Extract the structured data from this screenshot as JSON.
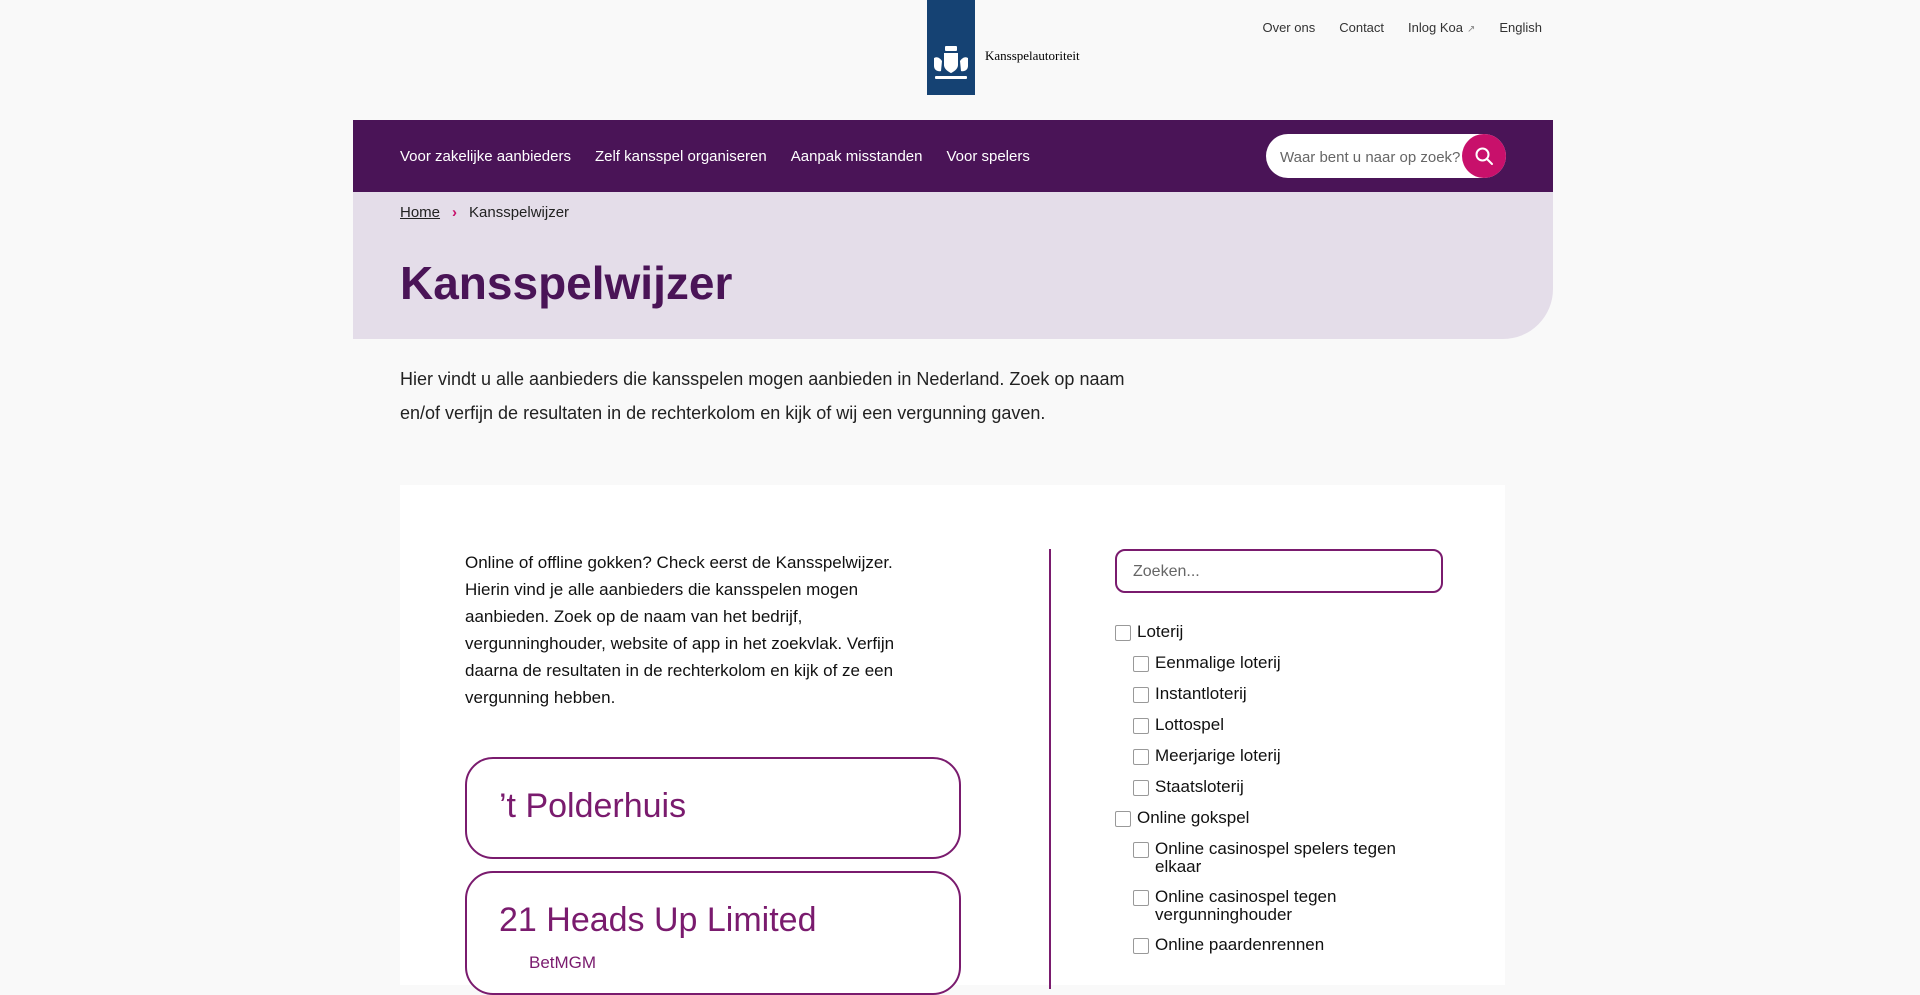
{
  "header": {
    "org_name": "Kansspelautoriteit",
    "top_links": [
      {
        "label": "Over ons"
      },
      {
        "label": "Contact"
      },
      {
        "label": "Inlog Koa",
        "external_icon": "external-link-icon"
      },
      {
        "label": "English"
      }
    ]
  },
  "nav": {
    "items": [
      {
        "label": "Voor zakelijke aanbieders"
      },
      {
        "label": "Zelf kansspel organiseren"
      },
      {
        "label": "Aanpak misstanden"
      },
      {
        "label": "Voor spelers"
      }
    ],
    "search_placeholder": "Waar bent u naar op zoek?",
    "search_icon": "search-icon"
  },
  "breadcrumb": {
    "home": "Home",
    "current": "Kansspelwijzer"
  },
  "page": {
    "title": "Kansspelwijzer",
    "intro": "Hier vindt u alle aanbieders die kansspelen mogen aanbieden in Nederland. Zoek op naam en/of verfijn de resultaten in de rechterkolom en kijk of wij een vergunning gaven."
  },
  "tool": {
    "description": "Online of offline gokken? Check eerst de Kansspelwijzer. Hierin vind je alle aanbieders die kansspelen mogen aanbieden. Zoek op de naam van het bedrijf, vergunninghouder, website of app in het zoekvlak. Verfijn daarna de resultaten in de rechterkolom en kijk of ze een vergunning hebben.",
    "results": [
      {
        "name": "’t Polderhuis",
        "sub": ""
      },
      {
        "name": "21 Heads Up Limited",
        "sub": "BetMGM"
      }
    ],
    "filter_search_placeholder": "Zoeken...",
    "filters": [
      {
        "label": "Loterij",
        "level": 0
      },
      {
        "label": "Eenmalige loterij",
        "level": 1
      },
      {
        "label": "Instantloterij",
        "level": 1
      },
      {
        "label": "Lottospel",
        "level": 1
      },
      {
        "label": "Meerjarige loterij",
        "level": 1
      },
      {
        "label": "Staatsloterij",
        "level": 1
      },
      {
        "label": "Online gokspel",
        "level": 0
      },
      {
        "label": "Online casinospel spelers tegen elkaar",
        "level": 1
      },
      {
        "label": "Online casinospel tegen vergunninghouder",
        "level": 1
      },
      {
        "label": "Online paardenrennen",
        "level": 1
      }
    ]
  },
  "colors": {
    "nav_bg": "#4a1457",
    "accent_pink": "#c8106b",
    "hero_bg": "#e4dde9",
    "brand_purple": "#7a1b6e",
    "logo_blue": "#154273"
  }
}
